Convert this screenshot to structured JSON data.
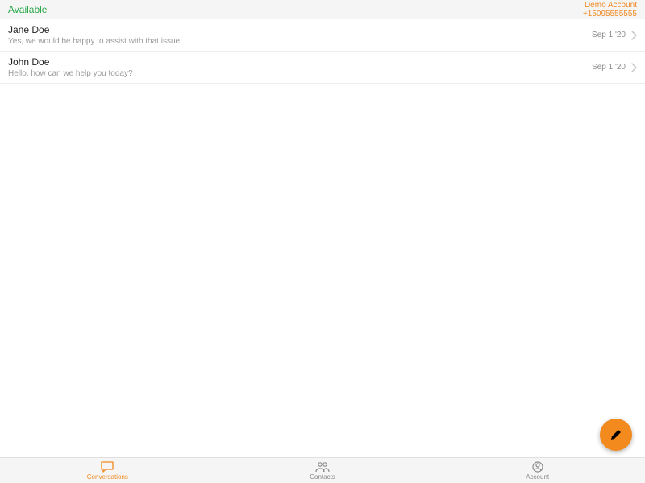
{
  "colors": {
    "accent": "#f28a1e",
    "success": "#2aa84a"
  },
  "status": {
    "availability": "Available",
    "account_name": "Demo Account",
    "phone": "+15095555555"
  },
  "conversations": [
    {
      "name": "Jane Doe",
      "preview": "Yes, we would be happy to assist with that issue.",
      "date": "Sep 1 '20"
    },
    {
      "name": "John Doe",
      "preview": "Hello, how can we help you today?",
      "date": "Sep 1 '20"
    }
  ],
  "tabs": [
    {
      "id": "conversations",
      "label": "Conversations",
      "active": true
    },
    {
      "id": "contacts",
      "label": "Contacts",
      "active": false
    },
    {
      "id": "account",
      "label": "Account",
      "active": false
    }
  ]
}
